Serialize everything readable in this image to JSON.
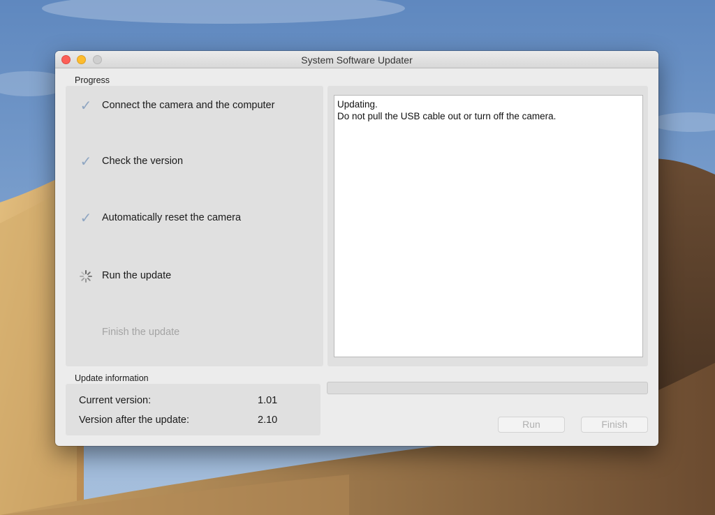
{
  "window": {
    "title": "System Software Updater"
  },
  "progress_section": {
    "label": "Progress",
    "steps": [
      {
        "label": "Connect the camera and the computer",
        "status": "done",
        "icon": "checkmark-icon"
      },
      {
        "label": "Check the version",
        "status": "done",
        "icon": "checkmark-icon"
      },
      {
        "label": "Automatically reset the camera",
        "status": "done",
        "icon": "checkmark-icon"
      },
      {
        "label": "Run the update",
        "status": "in-progress",
        "icon": "spinner-icon"
      },
      {
        "label": "Finish the update",
        "status": "pending",
        "icon": ""
      }
    ]
  },
  "log": {
    "lines": [
      "Updating.",
      "Do not pull the USB cable out or turn off the camera."
    ]
  },
  "update_info": {
    "label": "Update information",
    "current_version_label": "Current version:",
    "current_version": "1.01",
    "after_version_label": "Version after the update:",
    "after_version": "2.10"
  },
  "update_progress": 0,
  "buttons": {
    "run": "Run",
    "finish": "Finish"
  },
  "colors": {
    "check": "#8fa6c2",
    "close": "#fc5f57",
    "minimize": "#fdbc2e",
    "zoom_disabled": "#cfcfcf",
    "disabled_text": "#a4a4a4"
  }
}
